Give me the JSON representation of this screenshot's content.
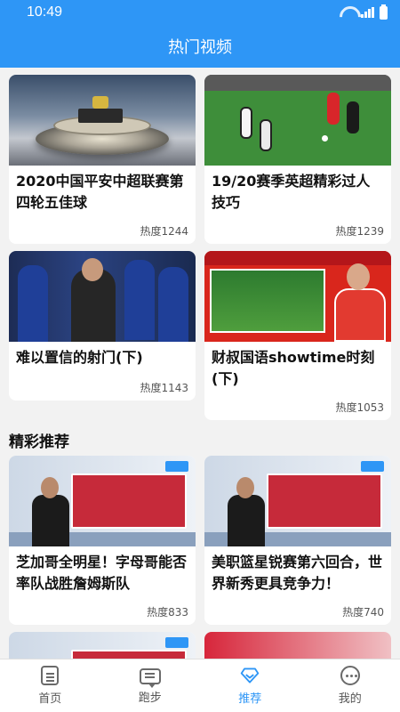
{
  "status_bar": {
    "time": "10:49"
  },
  "header": {
    "title": "热门视频"
  },
  "hot_videos": [
    {
      "title": "2020中国平安中超联赛第四轮五佳球",
      "heat": "热度1244",
      "thumb": "stadium-ceremony"
    },
    {
      "title": "19/20赛季英超精彩过人技巧",
      "heat": "热度1239",
      "thumb": "football-match"
    },
    {
      "title": "难以置信的射门(下)",
      "heat": "热度1143",
      "thumb": "coach-players"
    },
    {
      "title": "财叔国语showtime时刻(下)",
      "heat": "热度1053",
      "thumb": "tv-host"
    }
  ],
  "recommend": {
    "section_title": "精彩推荐",
    "items": [
      {
        "title": "芝加哥全明星！字母哥能否率队战胜詹姆斯队",
        "heat": "热度833",
        "thumb": "studio-commentator"
      },
      {
        "title": "美职篮星锐赛第六回合，世界新秀更具竞争力！",
        "heat": "热度740",
        "thumb": "studio-commentator"
      },
      {
        "title": "",
        "heat": "",
        "thumb": "studio-commentator"
      },
      {
        "title": "",
        "heat": "",
        "thumb": "red-banner"
      }
    ]
  },
  "tabbar": [
    {
      "label": "首页",
      "icon": "home-icon",
      "active": false
    },
    {
      "label": "跑步",
      "icon": "message-icon",
      "active": false
    },
    {
      "label": "推荐",
      "icon": "diamond-icon",
      "active": true
    },
    {
      "label": "我的",
      "icon": "profile-icon",
      "active": false
    }
  ],
  "colors": {
    "primary": "#2e96f6",
    "background": "#f2f2f2"
  }
}
